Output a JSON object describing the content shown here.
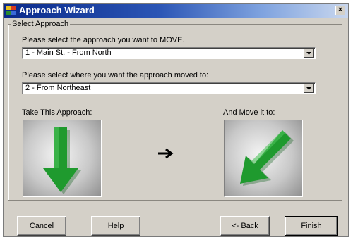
{
  "window": {
    "title": "Approach Wizard",
    "close_glyph": "×"
  },
  "group": {
    "legend": "Select Approach"
  },
  "move_select": {
    "label": "Please select the approach you want to MOVE.",
    "value": "1 - Main St. - From North"
  },
  "target_select": {
    "label": "Please select where you want the approach moved to:",
    "value": "2  - From Northeast"
  },
  "from_panel": {
    "label": "Take This Approach:",
    "icon": "arrow-down-icon"
  },
  "to_panel": {
    "label": "And Move it to:",
    "icon": "arrow-down-left-icon"
  },
  "buttons": {
    "cancel": "Cancel",
    "help": "Help",
    "back": "<- Back",
    "finish": "Finish"
  },
  "colors": {
    "arrow_green": "#1f9a2e",
    "title_blue": "#0a2a8a"
  }
}
